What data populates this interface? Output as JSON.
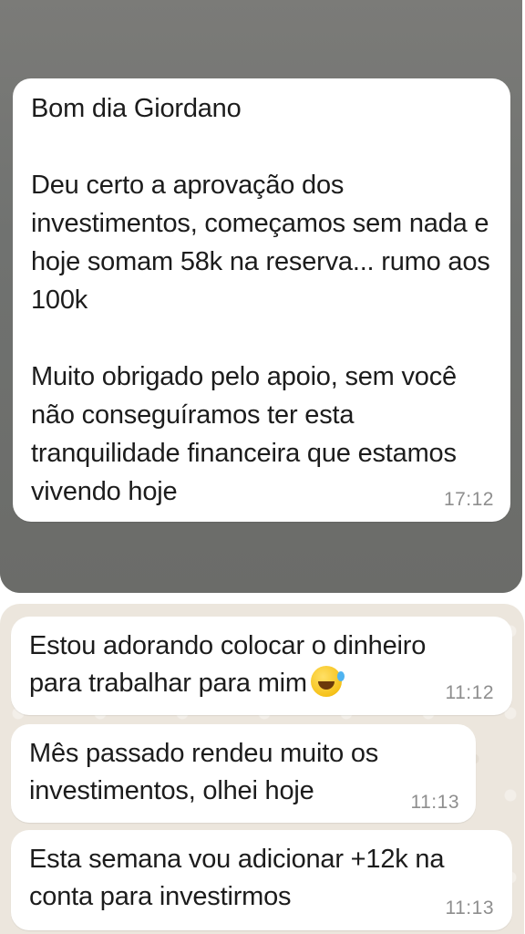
{
  "top_message": {
    "text": "Bom dia Giordano\n\nDeu certo a aprovação dos investimentos, começamos sem nada e hoje somam 58k na reserva... rumo aos 100k\n\nMuito obrigado pelo apoio, sem você não conseguíramos ter esta tranquilidade financeira que estamos vivendo hoje",
    "time": "17:12"
  },
  "messages": [
    {
      "text": "Estou adorando colocar o dinheiro\npara trabalhar para mim",
      "emoji": "rolling-on-floor-laughing-emoji",
      "time": "11:12"
    },
    {
      "text": "Mês passado rendeu muito os\ninvestimentos, olhei hoje",
      "time": "11:13"
    },
    {
      "text": "Esta semana vou adicionar +12k na\nconta para investirmos",
      "time": "11:13"
    }
  ],
  "colors": {
    "top_background": "#6e6e6b",
    "chat_background": "#ece6dd",
    "bubble": "#ffffff",
    "time_text": "#8e8e8e"
  }
}
